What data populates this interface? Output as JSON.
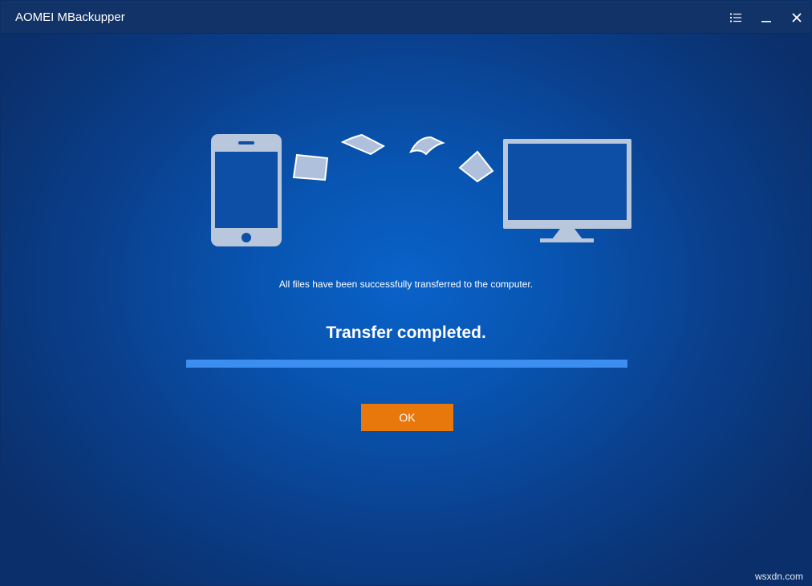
{
  "window": {
    "title": "AOMEI MBackupper"
  },
  "titlebar_icons": [
    "menu-icon",
    "minimize-icon",
    "close-icon"
  ],
  "main": {
    "message": "All files have been successfully transferred to the computer.",
    "status": "Transfer completed.",
    "progress_percent": 100,
    "ok_label": "OK"
  },
  "watermark": "wsxdn.com",
  "colors": {
    "titlebar": "#123368",
    "background": "#0a62c9",
    "progress_fill": "#3c8ff0",
    "ok_button": "#e8780c",
    "device_fill": "#b9c7dc"
  }
}
